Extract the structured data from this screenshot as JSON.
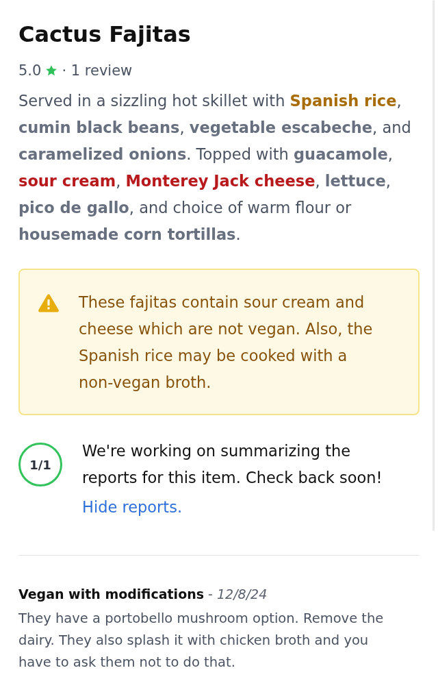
{
  "item": {
    "title": "Cactus Fajitas",
    "rating": {
      "score": "5.0",
      "reviews": "· 1 review"
    },
    "description": [
      {
        "kind": "plain",
        "text": "Served in a sizzling hot skillet with "
      },
      {
        "kind": "caution",
        "text": "Spanish rice"
      },
      {
        "kind": "plain",
        "text": ", "
      },
      {
        "kind": "ingredient",
        "text": "cumin black beans"
      },
      {
        "kind": "plain",
        "text": ", "
      },
      {
        "kind": "ingredient",
        "text": "vegetable escabeche"
      },
      {
        "kind": "plain",
        "text": ", and "
      },
      {
        "kind": "ingredient",
        "text": "caramelized onions"
      },
      {
        "kind": "plain",
        "text": ". Topped with "
      },
      {
        "kind": "ingredient",
        "text": "guacamole"
      },
      {
        "kind": "plain",
        "text": ", "
      },
      {
        "kind": "non_vegan",
        "text": "sour cream"
      },
      {
        "kind": "plain",
        "text": ", "
      },
      {
        "kind": "non_vegan",
        "text": "Monterey Jack cheese"
      },
      {
        "kind": "plain",
        "text": ", "
      },
      {
        "kind": "ingredient",
        "text": "lettuce"
      },
      {
        "kind": "plain",
        "text": ", "
      },
      {
        "kind": "ingredient",
        "text": "pico de gallo"
      },
      {
        "kind": "plain",
        "text": ", and choice of warm flour or "
      },
      {
        "kind": "ingredient",
        "text": "housemade corn tortillas"
      },
      {
        "kind": "plain",
        "text": "."
      }
    ]
  },
  "warning": {
    "text": "These fajitas contain sour cream and cheese which are not vegan. Also, the Spanish rice may be cooked with a non-vegan broth."
  },
  "reports": {
    "count": "1/1",
    "message": "We're working on summarizing the reports for this item. Check back soon!",
    "toggle_link": "Hide reports."
  },
  "review_list": [
    {
      "heading": "**Vegan with modifications** - *12/8/24*",
      "body": "They have a portobello mushroom option. Remove the dairy. They also splash it with chicken broth and you have to ask them not to do that."
    }
  ]
}
